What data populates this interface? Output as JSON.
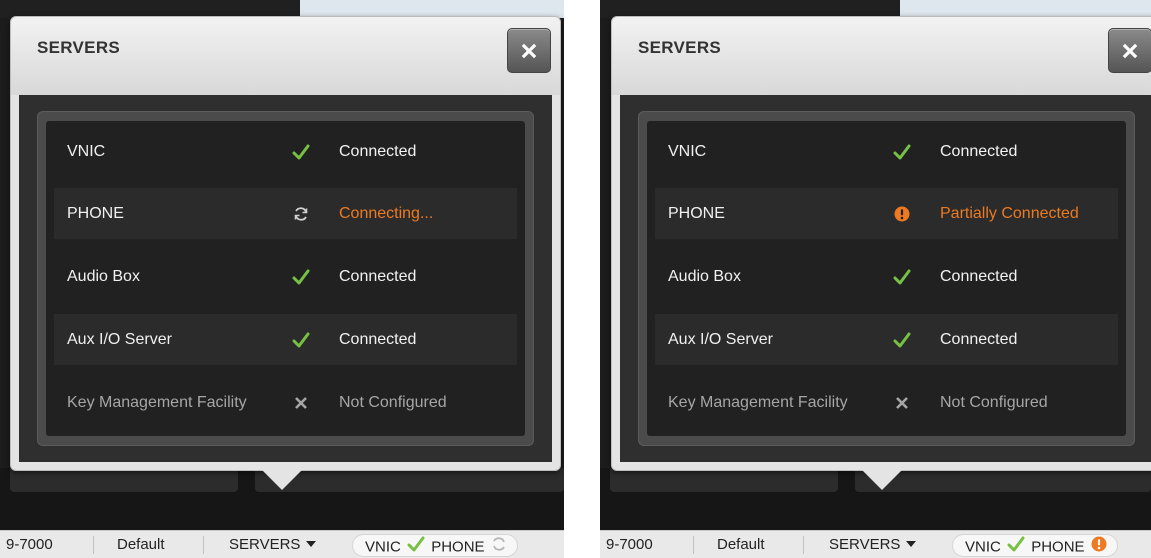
{
  "colors": {
    "accent_ok": "#76c043",
    "accent_warn": "#ec7a22",
    "muted": "#a6a6a6"
  },
  "left": {
    "dialog": {
      "title": "SERVERS",
      "close_icon": "close-icon",
      "rows": [
        {
          "name": "VNIC",
          "icon": "check-icon",
          "status": "Connected"
        },
        {
          "name": "PHONE",
          "icon": "sync-icon",
          "status": "Connecting..."
        },
        {
          "name": "Audio Box",
          "icon": "check-icon",
          "status": "Connected"
        },
        {
          "name": "Aux I/O Server",
          "icon": "check-icon",
          "status": "Connected"
        },
        {
          "name": "Key Management Facility",
          "icon": "x-icon",
          "status": "Not Configured"
        }
      ]
    },
    "statusbar": {
      "number": "9-7000",
      "profile": "Default",
      "servers_label": "SERVERS",
      "pill": {
        "vnic": "VNIC",
        "phone": "PHONE",
        "phone_icon": "sync-icon"
      }
    }
  },
  "right": {
    "dialog": {
      "title": "SERVERS",
      "close_icon": "close-icon",
      "rows": [
        {
          "name": "VNIC",
          "icon": "check-icon",
          "status": "Connected"
        },
        {
          "name": "PHONE",
          "icon": "warning-icon",
          "status": "Partially Connected"
        },
        {
          "name": "Audio Box",
          "icon": "check-icon",
          "status": "Connected"
        },
        {
          "name": "Aux I/O Server",
          "icon": "check-icon",
          "status": "Connected"
        },
        {
          "name": "Key Management Facility",
          "icon": "x-icon",
          "status": "Not Configured"
        }
      ]
    },
    "statusbar": {
      "number": "9-7000",
      "profile": "Default",
      "servers_label": "SERVERS",
      "pill": {
        "vnic": "VNIC",
        "phone": "PHONE",
        "phone_icon": "warning-icon"
      }
    }
  }
}
